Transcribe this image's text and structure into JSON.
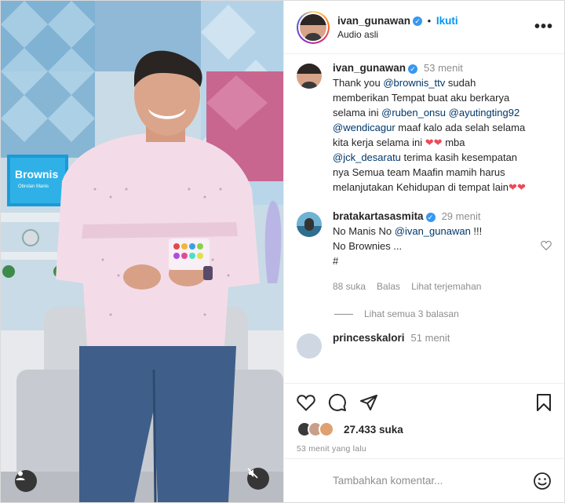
{
  "header": {
    "username": "ivan_gunawan",
    "follow_label": "Ikuti",
    "subtitle": "Audio asli",
    "more_label": "•••"
  },
  "caption": {
    "username": "ivan_gunawan",
    "time": "53 menit",
    "text_parts": {
      "p1": "Thank you ",
      "m1": "@brownis_ttv",
      "p2": " sudah memberikan Tempat buat aku berkarya selama ini ",
      "m2": "@ruben_onsu",
      "m3": "@ayutingting92",
      "m4": "@wendicagur",
      "p3": " maaf kalo ada selah selama kita kerja selama ini ",
      "p4": " mba ",
      "m5": "@jck_desaratu",
      "p5": " terima kasih kesempatan nya Semua team Maafin mamih harus melanjutakan Kehidupan di tempat lain",
      "hearts": "❤️❤️"
    }
  },
  "comments": [
    {
      "username": "bratakartasasmita",
      "time": "29 menit",
      "line1_prefix": "No Manis No ",
      "line1_mention": "@ivan_gunawan",
      "line1_suffix": " !!!",
      "line2": "No Brownies ...",
      "line3": "#",
      "likes": "88 suka",
      "reply_label": "Balas",
      "translate_label": "Lihat terjemahan",
      "view_replies": "Lihat semua 3 balasan"
    },
    {
      "username": "princesskalori",
      "time": "51 menit"
    }
  ],
  "actions": {
    "likes_count": "27.433 suka",
    "posted_ago": "53 menit yang lalu"
  },
  "add_comment": {
    "placeholder": "Tambahkan komentar..."
  },
  "video": {
    "sign_text": "Brownis",
    "sign_subtext": "Obrolan Manis"
  },
  "icons": {
    "heart": "heart-icon",
    "comment": "comment-icon",
    "share": "share-icon",
    "bookmark": "bookmark-icon",
    "emoji": "emoji-icon",
    "mute": "mute-icon",
    "user": "user-icon"
  },
  "colors": {
    "accent": "#0095f6",
    "verified": "#3897f0",
    "heart_red": "#ed4956",
    "text": "#262626",
    "muted": "#8e8e8e"
  }
}
